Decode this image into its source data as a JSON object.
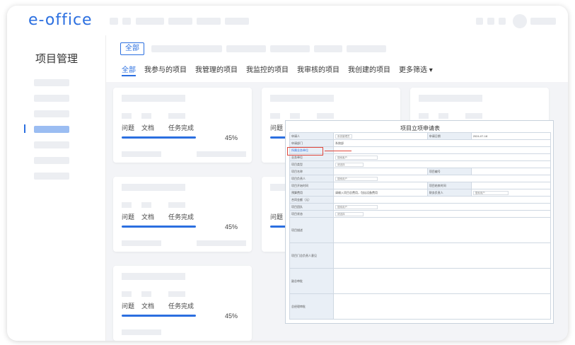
{
  "app": {
    "logo_text": "e-office"
  },
  "sidebar": {
    "title": "项目管理"
  },
  "filter": {
    "all_button": "全部",
    "tabs": [
      "全部",
      "我参与的项目",
      "我管理的项目",
      "我监控的项目",
      "我审核的项目",
      "我创建的项目",
      "更多筛选 ▾"
    ]
  },
  "cards": [
    {
      "stat_labels": [
        "问题",
        "文档",
        "任务完成"
      ],
      "progress": "45%"
    },
    {
      "stat_labels": [
        "问题"
      ],
      "progress": ""
    },
    {
      "stat_labels": [
        "问题",
        "文档",
        "任务完成"
      ],
      "progress": "45%"
    },
    {
      "stat_labels": [
        "问题"
      ],
      "progress": ""
    },
    {
      "stat_labels": [
        "问题",
        "文档",
        "任务完成"
      ],
      "progress": "45%"
    }
  ],
  "form": {
    "title": "项目立项申请表",
    "rows": [
      {
        "label": "申请人",
        "value": "系统管理员",
        "label2": "申请日期",
        "value2": "2024-07-18"
      },
      {
        "label": "申请部门",
        "value": "系统部"
      },
      {
        "label": "所属业务单位",
        "value": ""
      },
      {
        "label": "业务单位",
        "value": "搜索客户"
      },
      {
        "label": "项目类型",
        "value": "请选择"
      },
      {
        "label": "项目名称",
        "value": "",
        "label2": "项目编号",
        "value2": ""
      },
      {
        "label": "项目负责人",
        "value": "搜索用户"
      },
      {
        "label": "项目开始时间",
        "value": "",
        "label2": "项目结束时间",
        "value2": ""
      },
      {
        "label": "预算费用",
        "value": "请输入项目总费用，包括设备费用",
        "label2": "财务负责人",
        "value2": "搜索用户"
      },
      {
        "label": "合同金额（元）",
        "value": ""
      },
      {
        "label": "项目团队",
        "value": "搜索用户"
      },
      {
        "label": "项目状态",
        "value": "请选择"
      },
      {
        "label": "项目描述",
        "value": ""
      },
      {
        "label": "项目门总负责人意见",
        "value": ""
      },
      {
        "label": "副总审批",
        "value": ""
      },
      {
        "label": "总经理审批",
        "value": ""
      }
    ]
  }
}
